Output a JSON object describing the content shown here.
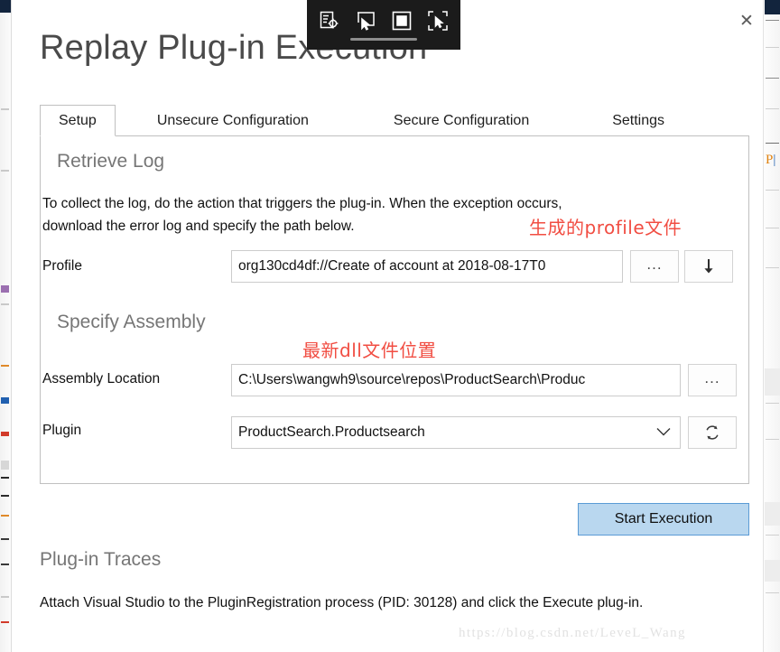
{
  "window": {
    "title": "Replay Plug-in Execution",
    "close_label": "✕"
  },
  "capture_toolbar": {
    "icons": [
      {
        "name": "inspect-element-icon",
        "label": "inspect-element-icon"
      },
      {
        "name": "cursor-capture-icon",
        "label": "cursor-capture-icon"
      },
      {
        "name": "region-capture-icon",
        "label": "region-capture-icon"
      },
      {
        "name": "selection-capture-icon",
        "label": "selection-capture-icon"
      }
    ]
  },
  "tabs": [
    {
      "label": "Setup",
      "active": true
    },
    {
      "label": "Unsecure Configuration",
      "active": false
    },
    {
      "label": "Secure Configuration",
      "active": false
    },
    {
      "label": "Settings",
      "active": false
    }
  ],
  "setup_panel": {
    "retrieve_log": {
      "heading": "Retrieve Log",
      "description": "To collect the log, do the action that triggers the plug-in. When the exception occurs, download the error log and specify the path below.",
      "profile": {
        "label": "Profile",
        "value": "org130cd4df://Create of account at 2018-08-17T0",
        "browse_label": "...",
        "download_label": "⬇"
      }
    },
    "specify_assembly": {
      "heading": "Specify Assembly",
      "assembly_location": {
        "label": "Assembly Location",
        "value": "C:\\Users\\wangwh9\\source\\repos\\ProductSearch\\Produc",
        "browse_label": "..."
      },
      "plugin": {
        "label": "Plugin",
        "value": "ProductSearch.Productsearch",
        "chevron": "⌄",
        "refresh_name": "refresh-icon"
      }
    }
  },
  "actions": {
    "start_execution_label": "Start Execution"
  },
  "plugin_traces": {
    "heading": "Plug-in Traces",
    "text": "Attach Visual Studio to the PluginRegistration process (PID: 30128) and click the Execute plug-in."
  },
  "annotations": [
    {
      "text": "生成的profile文件",
      "color": "#f14d42"
    },
    {
      "text": "最新dll文件位置",
      "color": "#f14d42"
    }
  ],
  "watermark": {
    "text": "https://blog.csdn.net/LeveL_Wang"
  },
  "colors": {
    "accent_button_fill": "#b9d7ef",
    "accent_button_border": "#5b9bd5",
    "annotation_red": "#f14d42",
    "heading_gray": "#767676",
    "toolbar_dark": "#1b1b1b"
  }
}
